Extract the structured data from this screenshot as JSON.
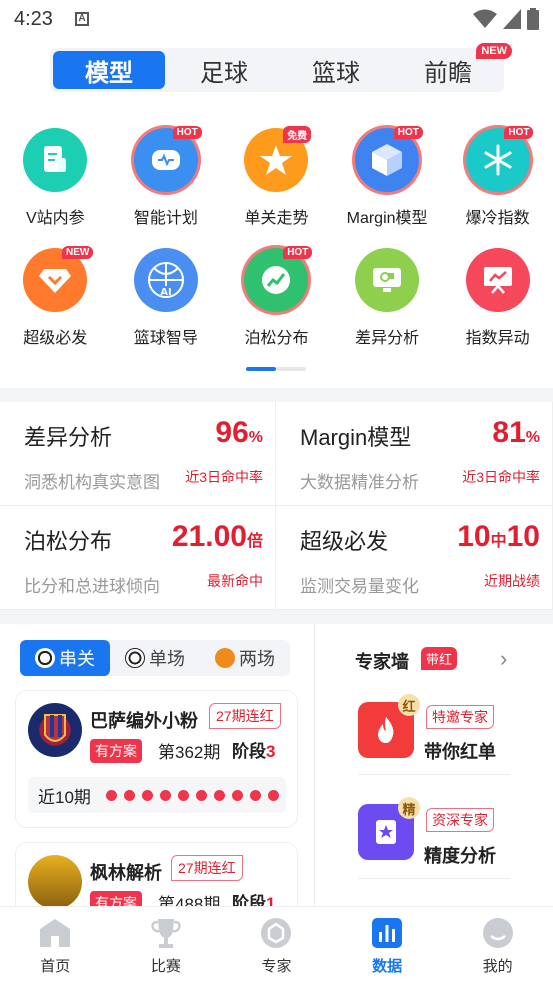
{
  "status_bar": {
    "time": "4:23"
  },
  "tabs": [
    {
      "label": "模型",
      "active": true
    },
    {
      "label": "足球",
      "active": false
    },
    {
      "label": "篮球",
      "active": false
    },
    {
      "label": "前瞻",
      "active": false,
      "badge": "NEW"
    }
  ],
  "grid": [
    {
      "label": "V站内参",
      "icon": "document-icon",
      "color": "#1ccfb3"
    },
    {
      "label": "智能计划",
      "icon": "robot-icon",
      "color": "#3a8ff0",
      "badge": "HOT"
    },
    {
      "label": "单关走势",
      "icon": "star-icon",
      "color": "#ff9b1c",
      "badge": "免费"
    },
    {
      "label": "Margin模型",
      "icon": "cube-icon",
      "color": "#3e83f0",
      "badge": "HOT"
    },
    {
      "label": "爆冷指数",
      "icon": "snowflake-icon",
      "color": "#1cc9c9",
      "badge": "HOT"
    },
    {
      "label": "超级必发",
      "icon": "diamond-icon",
      "color": "#ff7a2c",
      "badge": "NEW"
    },
    {
      "label": "篮球智导",
      "icon": "basketball-ai-icon",
      "color": "#4a8ef2"
    },
    {
      "label": "泊松分布",
      "icon": "trend-chart-icon",
      "color": "#2fc16f",
      "badge": "HOT"
    },
    {
      "label": "差异分析",
      "icon": "monitor-icon",
      "color": "#8ed04d"
    },
    {
      "label": "指数异动",
      "icon": "presentation-icon",
      "color": "#f5485a"
    }
  ],
  "stats": [
    {
      "title": "差异分析",
      "value": "96",
      "unit": "%",
      "desc": "洞悉机构真实意图",
      "tag": "近3日命中率"
    },
    {
      "title": "Margin模型",
      "value": "81",
      "unit": "%",
      "desc": "大数据精准分析",
      "tag": "近3日命中率"
    },
    {
      "title": "泊松分布",
      "value": "21.00",
      "unit": "倍",
      "desc": "比分和总进球倾向",
      "tag": "最新命中"
    },
    {
      "title": "超级必发",
      "value": "10",
      "mid": "中",
      "value2": "10",
      "desc": "监测交易量变化",
      "tag": "近期战绩"
    }
  ],
  "filter": [
    {
      "label": "串关",
      "active": true
    },
    {
      "label": "单场",
      "active": false
    },
    {
      "label": "两场",
      "active": false
    }
  ],
  "cards": [
    {
      "name": "巴萨编外小粉",
      "streak": "27期连红",
      "plan": "有方案",
      "period": "第362期",
      "stage_label": "阶段",
      "stage_num": "3",
      "record_label": "近10期",
      "record_hits": 10
    },
    {
      "name": "枫林解析",
      "streak": "27期连红",
      "plan": "有方案",
      "period": "第488期",
      "stage_label": "阶段",
      "stage_num": "1"
    }
  ],
  "expert_wall": {
    "title": "专家墙",
    "badge": "带红",
    "items": [
      {
        "mark": "红",
        "tag": "特邀专家",
        "title": "带你红单",
        "color": "#f23b3b"
      },
      {
        "mark": "精",
        "tag": "资深专家",
        "title": "精度分析",
        "color": "#6c4cf0"
      }
    ]
  },
  "bottom_nav": [
    {
      "label": "首页",
      "icon": "home-icon",
      "active": false
    },
    {
      "label": "比赛",
      "icon": "trophy-icon",
      "active": false
    },
    {
      "label": "专家",
      "icon": "expert-icon",
      "active": false
    },
    {
      "label": "数据",
      "icon": "data-chart-icon",
      "active": true
    },
    {
      "label": "我的",
      "icon": "profile-icon",
      "active": false
    }
  ]
}
